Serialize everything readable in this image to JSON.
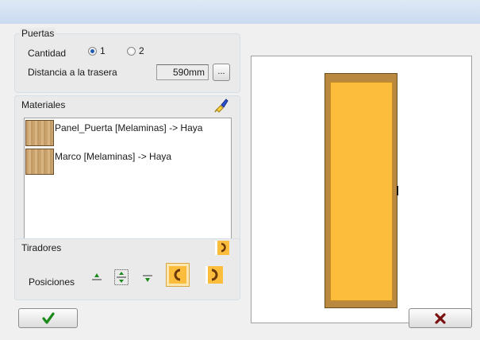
{
  "puertas": {
    "title": "Puertas",
    "cantidad_label": "Cantidad",
    "option1": "1",
    "option2": "2",
    "selected": "1",
    "distancia_label": "Distancia a la trasera",
    "distancia_value": "590mm",
    "browse_label": "..."
  },
  "materiales": {
    "title": "Materiales",
    "items": [
      {
        "label": "Panel_Puerta [Melaminas] -> Haya"
      },
      {
        "label": "Marco [Melaminas] -> Haya"
      }
    ]
  },
  "tiradores": {
    "title": "Tiradores",
    "posiciones_label": "Posiciones"
  },
  "colors": {
    "door_panel": "#fdbd3c",
    "door_frame": "#b8893f",
    "accept": "#1a8a1a",
    "cancel": "#7a1010"
  }
}
